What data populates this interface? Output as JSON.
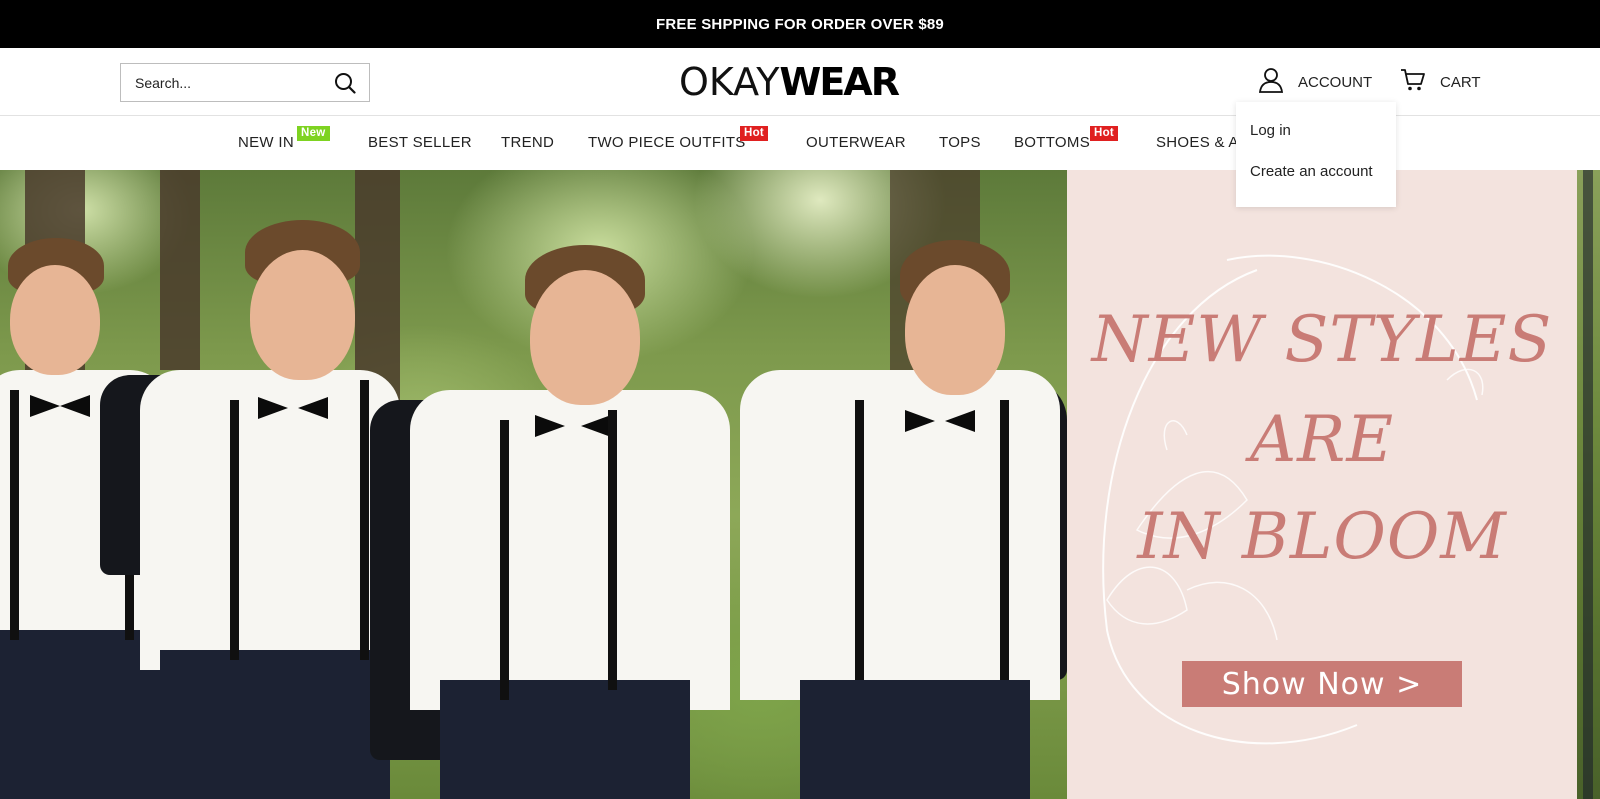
{
  "announcement": {
    "text": "FREE SHPPING FOR ORDER OVER $89"
  },
  "header": {
    "search_placeholder": "Search...",
    "logo": {
      "light": "OKAY",
      "bold": "WEAR"
    },
    "account_label": "ACCOUNT",
    "cart_label": "CART"
  },
  "account_menu": {
    "items": [
      "Log in",
      "Create an account"
    ]
  },
  "nav": {
    "items": [
      {
        "label": "NEW IN",
        "tag": "New"
      },
      {
        "label": "BEST SELLER"
      },
      {
        "label": "TREND"
      },
      {
        "label": "TWO PIECE OUTFITS",
        "tag": "Hot"
      },
      {
        "label": "OUTERWEAR"
      },
      {
        "label": "TOPS"
      },
      {
        "label": "BOTTOMS",
        "tag": "Hot"
      },
      {
        "label": "SHOES & A"
      }
    ]
  },
  "hero": {
    "lines": [
      "NEW STYLES",
      "ARE",
      "IN BLOOM"
    ],
    "cta": "Show Now >"
  },
  "colors": {
    "accent": "#c97c76",
    "promo_bg": "#f3e3de",
    "tag_new": "#7ed321",
    "tag_hot": "#e02020"
  }
}
